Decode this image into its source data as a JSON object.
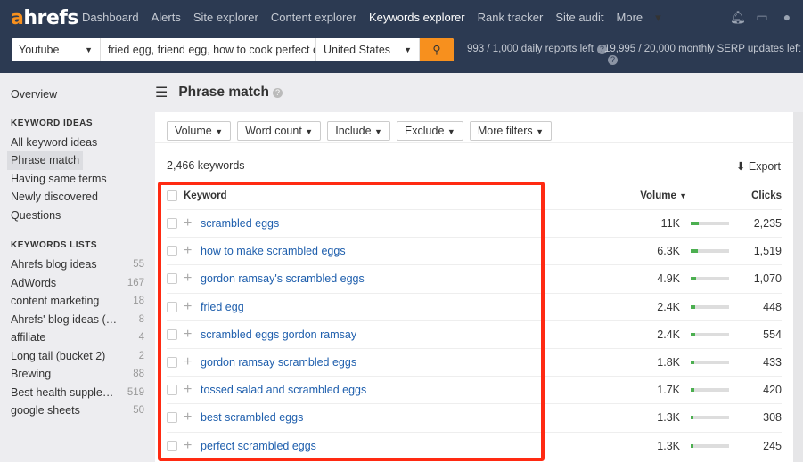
{
  "brand": {
    "logo": "ahrefs",
    "accent": "#f7901e"
  },
  "nav": [
    "Dashboard",
    "Alerts",
    "Site explorer",
    "Content explorer",
    "Keywords explorer",
    "Rank tracker",
    "Site audit",
    "More"
  ],
  "nav_active": "Keywords explorer",
  "search": {
    "source": "Youtube",
    "query": "fried egg, friend egg, how to cook perfect eg",
    "country": "United States"
  },
  "quota": {
    "reports": "993 / 1,000 daily reports left",
    "serp": "19,995 / 20,000 monthly SERP updates left"
  },
  "sidebar": {
    "overview": "Overview",
    "ideas_heading": "KEYWORD IDEAS",
    "ideas": [
      "All keyword ideas",
      "Phrase match",
      "Having same terms",
      "Newly discovered",
      "Questions"
    ],
    "lists_heading": "KEYWORDS LISTS",
    "lists": [
      {
        "name": "Ahrefs blog ideas",
        "count": "55"
      },
      {
        "name": "AdWords",
        "count": "167"
      },
      {
        "name": "content marketing",
        "count": "18"
      },
      {
        "name": "Ahrefs' blog ideas (…",
        "count": "8"
      },
      {
        "name": "affiliate",
        "count": "4"
      },
      {
        "name": "Long tail (bucket 2)",
        "count": "2"
      },
      {
        "name": "Brewing",
        "count": "88"
      },
      {
        "name": "Best health supple…",
        "count": "519"
      },
      {
        "name": "google sheets",
        "count": "50"
      }
    ]
  },
  "page_title": "Phrase match",
  "filters": [
    "Volume",
    "Word count",
    "Include",
    "Exclude",
    "More filters"
  ],
  "keyword_count": "2,466 keywords",
  "export_label": "Export",
  "table": {
    "headers": {
      "keyword": "Keyword",
      "volume": "Volume",
      "clicks": "Clicks"
    },
    "rows": [
      {
        "keyword": "scrambled eggs",
        "volume": "11K",
        "clicks": "2,235",
        "bar": 0.22
      },
      {
        "keyword": "how to make scrambled eggs",
        "volume": "6.3K",
        "clicks": "1,519",
        "bar": 0.18
      },
      {
        "keyword": "gordon ramsay's scrambled eggs",
        "volume": "4.9K",
        "clicks": "1,070",
        "bar": 0.15
      },
      {
        "keyword": "fried egg",
        "volume": "2.4K",
        "clicks": "448",
        "bar": 0.12
      },
      {
        "keyword": "scrambled eggs gordon ramsay",
        "volume": "2.4K",
        "clicks": "554",
        "bar": 0.12
      },
      {
        "keyword": "gordon ramsay scrambled eggs",
        "volume": "1.8K",
        "clicks": "433",
        "bar": 0.1
      },
      {
        "keyword": "tossed salad and scrambled eggs",
        "volume": "1.7K",
        "clicks": "420",
        "bar": 0.1
      },
      {
        "keyword": "best scrambled eggs",
        "volume": "1.3K",
        "clicks": "308",
        "bar": 0.08
      },
      {
        "keyword": "perfect scrambled eggs",
        "volume": "1.3K",
        "clicks": "245",
        "bar": 0.08
      }
    ]
  },
  "highlight_color": "#ff2a12"
}
